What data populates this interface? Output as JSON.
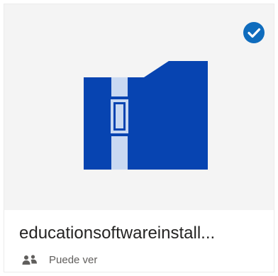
{
  "tile": {
    "file_name": "educationsoftwareinstall...",
    "permission": "Puede ver",
    "selected": true,
    "icons": {
      "selected": "checkmark-circle-icon",
      "file": "package-file-icon",
      "shared": "people-icon"
    },
    "colors": {
      "accent": "#0f6cbd",
      "file_icon_primary": "#0744b1",
      "file_icon_strap": "#c9d9f2",
      "thumbnail_background": "#f4f4f4"
    }
  }
}
